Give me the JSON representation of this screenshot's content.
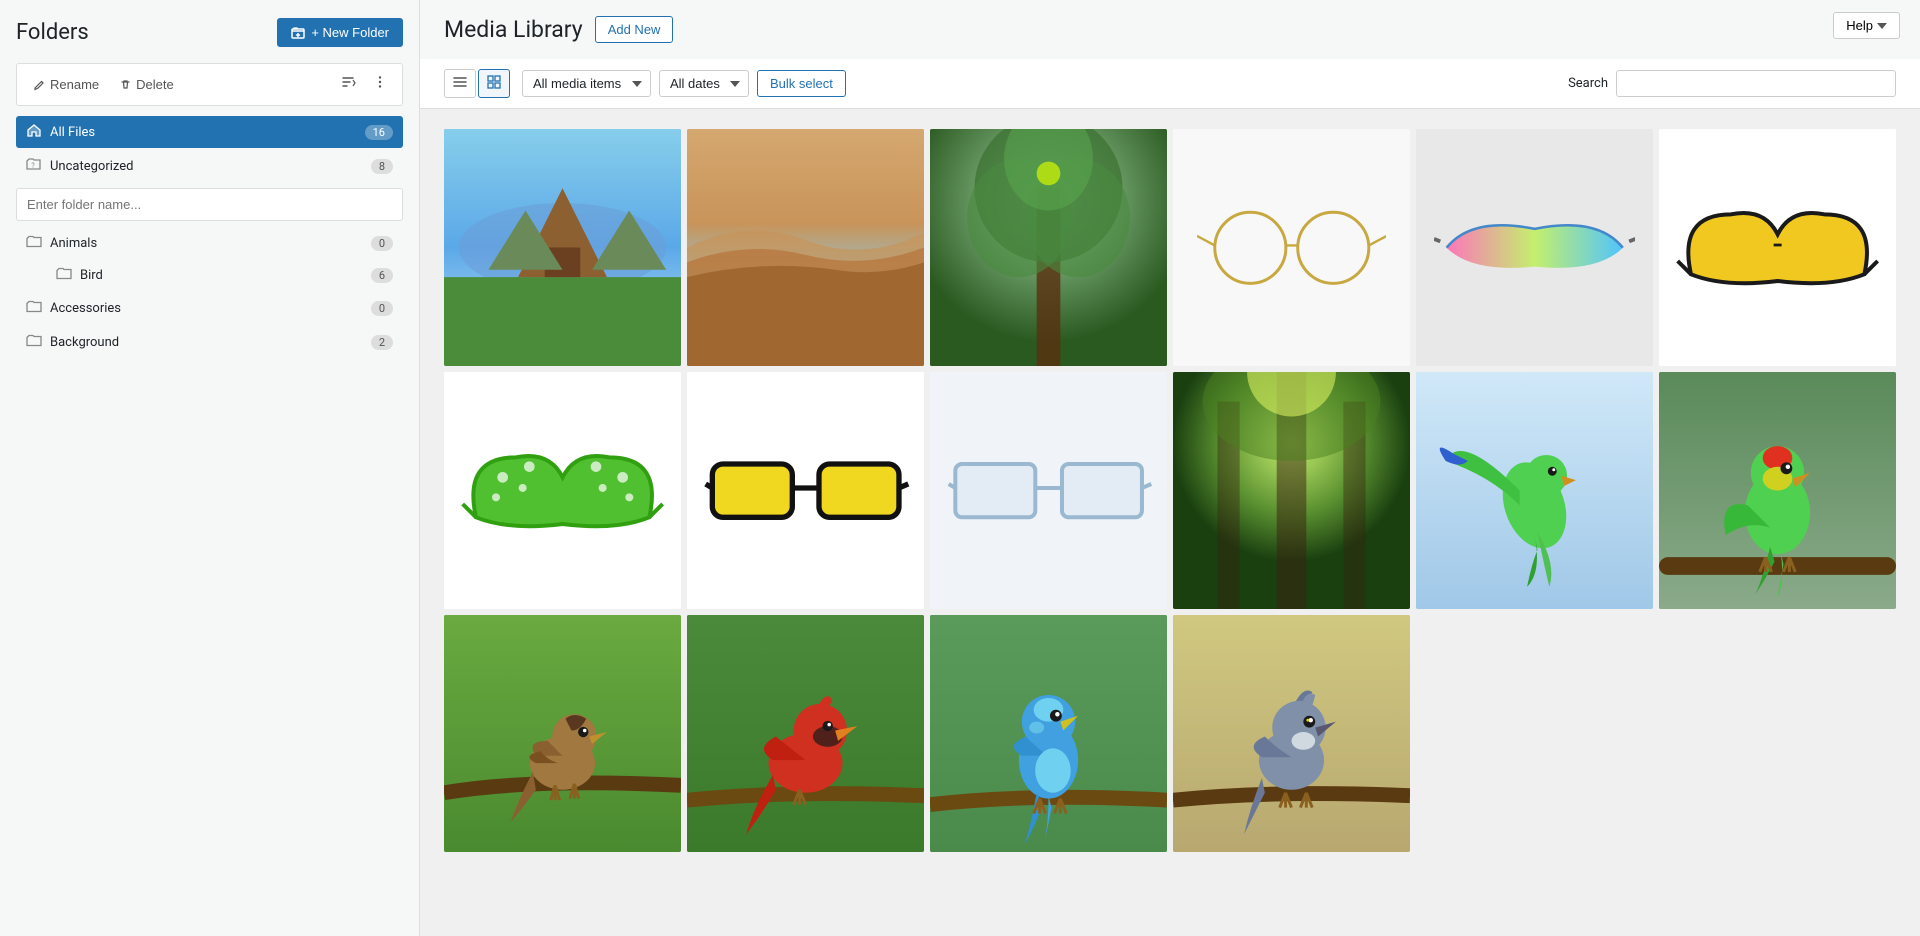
{
  "sidebar": {
    "title": "Folders",
    "new_folder_label": "+ New Folder",
    "rename_label": "Rename",
    "delete_label": "Delete",
    "folder_input_placeholder": "Enter folder name...",
    "all_files_label": "All Files",
    "all_files_count": "16",
    "uncategorized_label": "Uncategorized",
    "uncategorized_count": "8",
    "folders": [
      {
        "label": "Animals",
        "count": "0",
        "sub": [
          {
            "label": "Bird",
            "count": "6"
          }
        ]
      },
      {
        "label": "Accessories",
        "count": "0",
        "sub": []
      },
      {
        "label": "Background",
        "count": "2",
        "sub": []
      }
    ]
  },
  "main": {
    "title": "Media Library",
    "add_new_label": "Add New",
    "help_label": "Help",
    "filter": {
      "all_media_label": "All media items",
      "all_dates_label": "All dates",
      "bulk_select_label": "Bulk select",
      "search_label": "Search"
    },
    "media_items": [
      {
        "id": 1,
        "type": "landscape",
        "class": "thumb-landscape"
      },
      {
        "id": 2,
        "type": "desert",
        "class": "thumb-desert"
      },
      {
        "id": 3,
        "type": "tree",
        "class": "thumb-tree"
      },
      {
        "id": 4,
        "type": "glasses-clear",
        "class": "thumb-glasses-clear"
      },
      {
        "id": 5,
        "type": "glasses-pink",
        "class": "thumb-glasses-pink"
      },
      {
        "id": 6,
        "type": "glasses-yellow",
        "class": "thumb-glasses-yellow"
      },
      {
        "id": 7,
        "type": "glasses-green",
        "class": "thumb-glasses-green"
      },
      {
        "id": 8,
        "type": "glasses-black",
        "class": "thumb-glasses-black"
      },
      {
        "id": 9,
        "type": "glasses-clear2",
        "class": "thumb-glasses-clear2"
      },
      {
        "id": 10,
        "type": "forest",
        "class": "thumb-forest"
      },
      {
        "id": 11,
        "type": "parrot-fly",
        "class": "thumb-parrot-fly"
      },
      {
        "id": 12,
        "type": "bird-colorful",
        "class": "thumb-bird-colorful"
      },
      {
        "id": 13,
        "type": "bird-brown",
        "class": "thumb-bird-brown"
      },
      {
        "id": 14,
        "type": "bird-red",
        "class": "thumb-bird-red"
      },
      {
        "id": 15,
        "type": "bird-blue",
        "class": "thumb-bird-blue"
      },
      {
        "id": 16,
        "type": "bird-gray",
        "class": "thumb-bird-gray"
      }
    ]
  },
  "colors": {
    "accent": "#2271b1",
    "border": "#ddd",
    "bg": "#f0f0f1"
  }
}
